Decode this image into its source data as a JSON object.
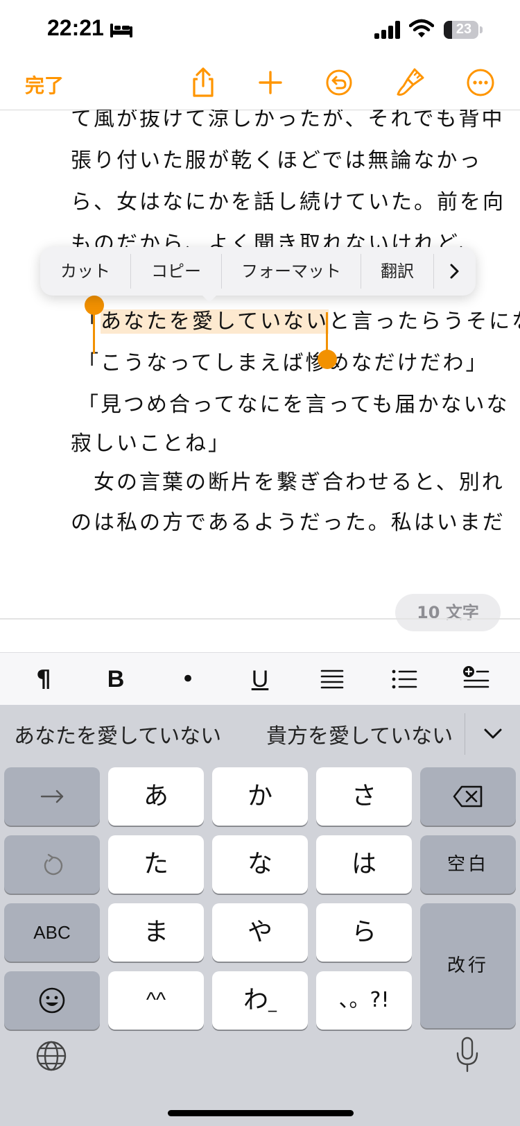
{
  "status": {
    "time": "22:21",
    "battery": "23",
    "icons": [
      "bed-icon",
      "cellular-signal-icon",
      "wifi-icon",
      "battery-icon"
    ]
  },
  "toolbar": {
    "done_label": "完了",
    "icons": [
      "share-icon",
      "add-icon",
      "undo-icon",
      "paintbrush-icon",
      "more-icon"
    ],
    "accent_color": "#ff9500"
  },
  "document": {
    "lines": [
      "て風が抜けて涼しかったが、それでも背中",
      "張り付いた服が乾くほどでは無論なかっ",
      "ら、女はなにかを話し続けていた。前を向",
      "ものだから、よく聞き取れないけれど、"
    ],
    "selected_line": {
      "prefix": "「",
      "selected": "あなたを愛していない",
      "suffix": "と言ったらうそにな"
    },
    "lines_after": [
      "「こうなってしまえば惨めなだけだわ」",
      "「見つめ合ってなにを言っても届かないな",
      "寂しいことね」",
      "　女の言葉の断片を繋ぎ合わせると、別れ",
      "のは私の方であるようだった。私はいまだ"
    ],
    "selection_color": "#fde9cf"
  },
  "context_menu": {
    "items": [
      "カット",
      "コピー",
      "フォーマット",
      "翻訳"
    ],
    "more_icon": "chevron-right-icon"
  },
  "word_count": "10 文字",
  "format_bar": {
    "paragraph": "¶",
    "bold": "B",
    "bullet": "•",
    "underline": "U",
    "icons": [
      "align-icon",
      "list-icon",
      "insert-icon"
    ]
  },
  "keyboard": {
    "candidates": [
      "あなたを愛していない",
      "貴方を愛していない"
    ],
    "rows": [
      [
        "あ",
        "か",
        "さ"
      ],
      [
        "た",
        "な",
        "は"
      ],
      [
        "ま",
        "や",
        "ら"
      ],
      [
        "^^",
        "わ",
        "、。?!"
      ]
    ],
    "space_label": "空白",
    "abc_label": "ABC",
    "return_label": "改行",
    "wa_underline": "_"
  }
}
